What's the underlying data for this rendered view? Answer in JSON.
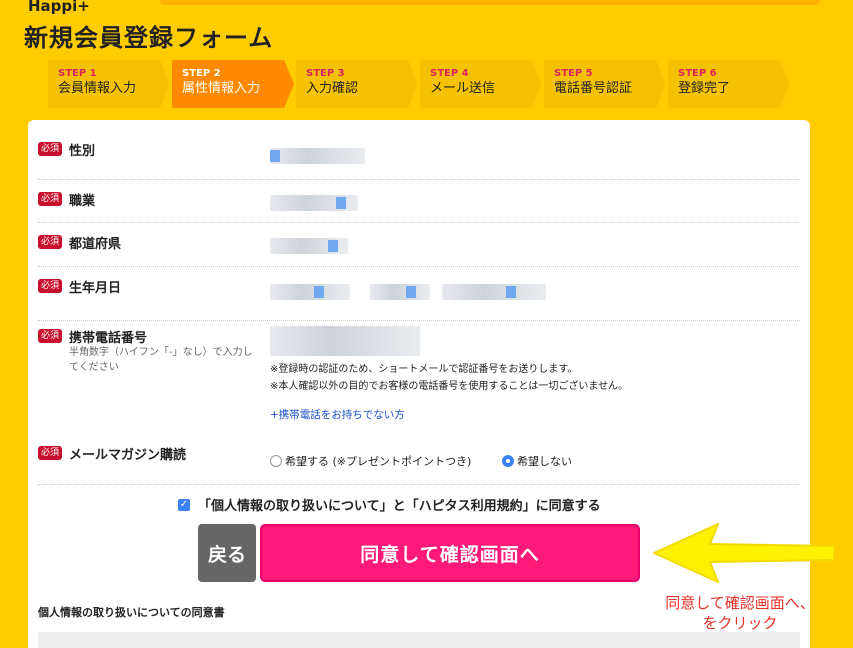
{
  "app": {
    "logo": "Happi+"
  },
  "page": {
    "title": "新規会員登録フォーム"
  },
  "steps": [
    {
      "num": "STEP 1",
      "label": "会員情報入力",
      "active": false
    },
    {
      "num": "STEP 2",
      "label": "属性情報入力",
      "active": true
    },
    {
      "num": "STEP 3",
      "label": "入力確認",
      "active": false
    },
    {
      "num": "STEP 4",
      "label": "メール送信",
      "active": false
    },
    {
      "num": "STEP 5",
      "label": "電話番号認証",
      "active": false
    },
    {
      "num": "STEP 6",
      "label": "登録完了",
      "active": false
    }
  ],
  "form": {
    "required_badge": "必須",
    "gender": {
      "label": "性別"
    },
    "occupation": {
      "label": "職業"
    },
    "prefecture": {
      "label": "都道府県"
    },
    "birthdate": {
      "label": "生年月日"
    },
    "phone": {
      "label": "携帯電話番号",
      "hint": "半角数字（ハイフン「-」なし）で入力してください",
      "note1": "※登録時の認証のため、ショートメールで認証番号をお送りします。",
      "note2": "※本人確認以外の目的でお客様の電話番号を使用することは一切ございません。",
      "no_phone_link": "+携帯電話をお持ちでない方"
    },
    "newsletter": {
      "label": "メールマガジン購読",
      "option_yes": "希望する (※プレゼントポイントつき)",
      "option_no": "希望しない"
    }
  },
  "agreement": {
    "text": "「個人情報の取り扱いについて」と「ハピタス利用規約」に同意する",
    "checked": true
  },
  "buttons": {
    "back": "戻る",
    "submit": "同意して確認画面へ"
  },
  "consent": {
    "title": "個人情報の取り扱いについての同意書"
  },
  "annotation": {
    "line1": "同意して確認画面へ、",
    "line2": "をクリック"
  },
  "colors": {
    "background": "#FFCC00",
    "submit": "#FF1A7A",
    "active_step": "#FF8A00",
    "required": "#C8102E"
  }
}
